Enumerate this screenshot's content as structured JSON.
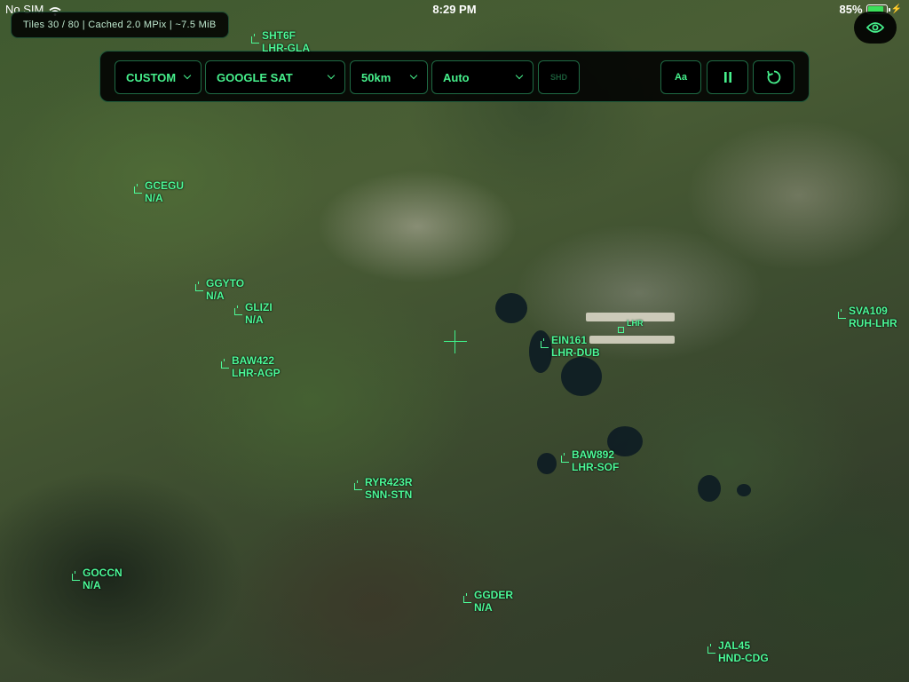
{
  "status_bar": {
    "carrier": "No SIM",
    "time": "8:29 PM",
    "battery": "85%",
    "battery_level": 0.85
  },
  "tile_info": "Tiles 30 / 80 | Cached 2.0 MPix | ~7.5 MiB",
  "toolbar": {
    "preset": "CUSTOM",
    "map_source": "GOOGLE SAT",
    "range": "50km",
    "mode": "Auto",
    "disabled_label": "SHD",
    "font_button": "Aa",
    "pause_icon": "pause-icon",
    "refresh_icon": "refresh-icon"
  },
  "eye_icon": "eye-icon",
  "airport": {
    "code": "LHR"
  },
  "aircraft": [
    {
      "callsign": "SHT6F",
      "route": "LHR-GLA"
    },
    {
      "callsign": "GCEGU",
      "route": "N/A"
    },
    {
      "callsign": "GGYTO",
      "route": "N/A"
    },
    {
      "callsign": "GLIZI",
      "route": "N/A"
    },
    {
      "callsign": "BAW422",
      "route": "LHR-AGP"
    },
    {
      "callsign": "EIN161",
      "route": "LHR-DUB"
    },
    {
      "callsign": "SVA109",
      "route": "RUH-LHR"
    },
    {
      "callsign": "BAW892",
      "route": "LHR-SOF"
    },
    {
      "callsign": "RYR423R",
      "route": "SNN-STN"
    },
    {
      "callsign": "GOCCN",
      "route": "N/A"
    },
    {
      "callsign": "GGDER",
      "route": "N/A"
    },
    {
      "callsign": "JAL45",
      "route": "HND-CDG"
    }
  ]
}
